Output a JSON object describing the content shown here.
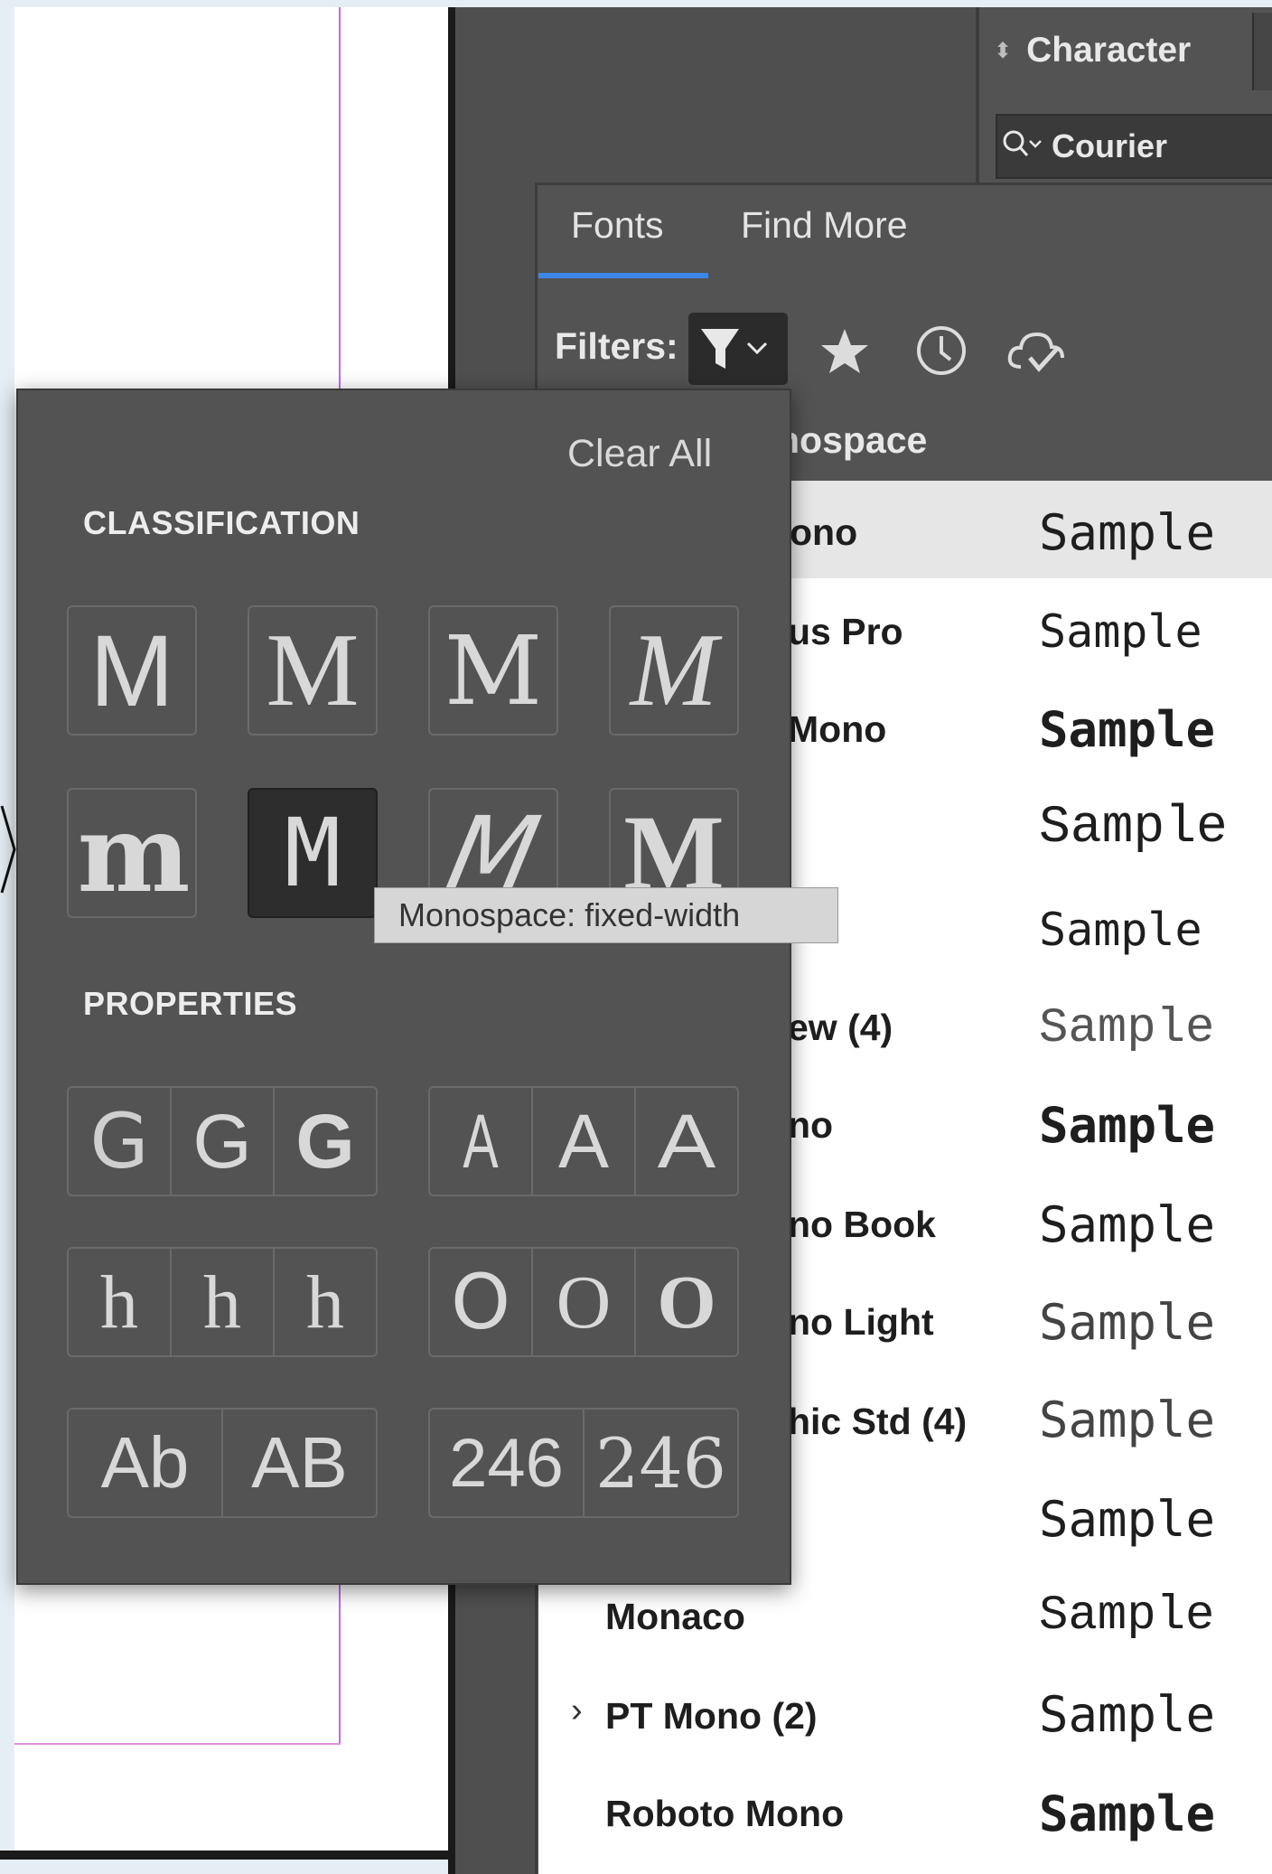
{
  "character_panel": {
    "title": "Character",
    "font_value": "Courier"
  },
  "font_menu": {
    "tabs": [
      "Fonts",
      "Find More"
    ],
    "filters_label": "Filters:",
    "list_header": "nospace",
    "rows": [
      {
        "name": "ono",
        "sample": "Sample",
        "expandable": false
      },
      {
        "name": "us Pro",
        "sample": "Sample",
        "expandable": false
      },
      {
        "name": "Mono",
        "sample": "Sample",
        "expandable": false
      },
      {
        "name": "",
        "sample": "Sample",
        "expandable": false
      },
      {
        "name": "",
        "sample": "Sample",
        "expandable": false
      },
      {
        "name": "ew (4)",
        "sample": "Sample",
        "expandable": false
      },
      {
        "name": "no",
        "sample": "Sample",
        "expandable": false
      },
      {
        "name": "no Book",
        "sample": "Sample",
        "expandable": false
      },
      {
        "name": "no Light",
        "sample": "Sample",
        "expandable": false
      },
      {
        "name": "hic Std (4)",
        "sample": "Sample",
        "expandable": false
      },
      {
        "name": "",
        "sample": "Sample",
        "expandable": false
      },
      {
        "name": "Monaco",
        "sample": "Sample",
        "expandable": false
      },
      {
        "name": "PT Mono (2)",
        "sample": "Sample",
        "expandable": true
      },
      {
        "name": "Roboto Mono",
        "sample": "Sample",
        "expandable": false
      }
    ]
  },
  "filter_flyout": {
    "clear_all": "Clear All",
    "classification_title": "CLASSIFICATION",
    "properties_title": "PROPERTIES",
    "classification_tiles": [
      {
        "glyph": "M",
        "name": "sans-serif"
      },
      {
        "glyph": "M",
        "name": "serif"
      },
      {
        "glyph": "M",
        "name": "slab-serif"
      },
      {
        "glyph": "M",
        "name": "script"
      },
      {
        "glyph": "m",
        "name": "blackletter"
      },
      {
        "glyph": "M",
        "name": "monospace"
      },
      {
        "glyph": "M",
        "name": "handwritten"
      },
      {
        "glyph": "M",
        "name": "decorative"
      }
    ],
    "property_groups": [
      [
        "G",
        "G",
        "G"
      ],
      [
        "A",
        "A",
        "A"
      ],
      [
        "h",
        "h",
        "h"
      ],
      [
        "O",
        "O",
        "O"
      ],
      [
        "Ab",
        "AB"
      ],
      [
        "246",
        "246"
      ]
    ],
    "tooltip": "Monospace: fixed-width"
  },
  "colors": {
    "accent": "#3b86e8",
    "panel": "#535353",
    "active_tile": "#2d2d2d"
  }
}
